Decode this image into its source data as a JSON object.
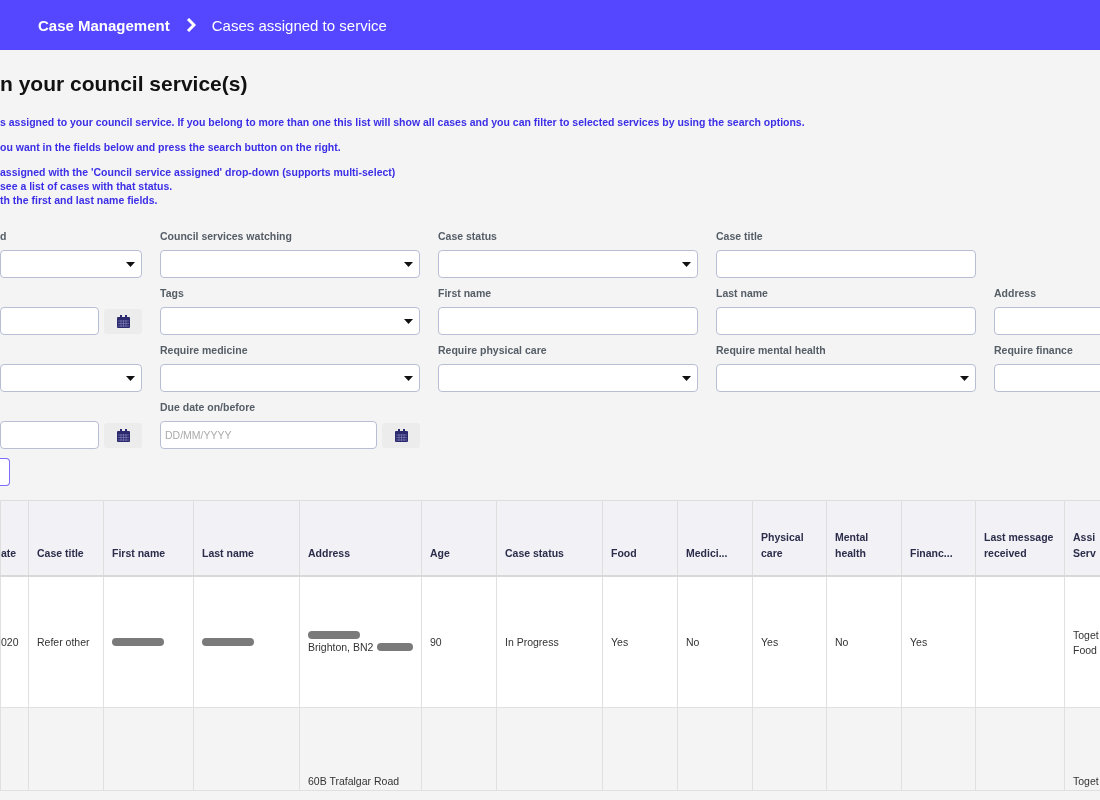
{
  "breadcrumb": {
    "parent": "Case Management",
    "current": "Cases assigned to service"
  },
  "heading": "n your council service(s)",
  "intro": [
    [
      "s assigned to your council service. If you belong to more than one this list will show all cases and you can filter to selected services by using the search options."
    ],
    [
      "ou want in the fields below and press the search button on the right."
    ],
    [
      "assigned with the 'Council service assigned' drop-down (supports multi-select)",
      "see a list of cases with that status.",
      "th the first and last name fields."
    ]
  ],
  "filters": [
    [
      {
        "kind": "select",
        "label": "d"
      },
      {
        "kind": "select",
        "label": "Council services watching"
      },
      {
        "kind": "select",
        "label": "Case status"
      },
      {
        "kind": "text",
        "label": "Case title"
      },
      {
        "kind": "empty"
      }
    ],
    [
      {
        "kind": "date"
      },
      {
        "kind": "select",
        "label": "Tags"
      },
      {
        "kind": "text",
        "label": "First name"
      },
      {
        "kind": "text",
        "label": "Last name"
      },
      {
        "kind": "text",
        "label": "Address"
      }
    ],
    [
      {
        "kind": "select"
      },
      {
        "kind": "select",
        "label": "Require medicine"
      },
      {
        "kind": "select",
        "label": "Require physical care"
      },
      {
        "kind": "select",
        "label": "Require mental health"
      },
      {
        "kind": "text",
        "label": "Require finance"
      }
    ],
    [
      {
        "kind": "date"
      },
      {
        "kind": "date",
        "label": "Due date on/before",
        "placeholder": "DD/MM/YYYY"
      },
      {
        "kind": "empty"
      },
      {
        "kind": "empty"
      },
      {
        "kind": "empty"
      }
    ],
    [
      {
        "kind": "button"
      },
      {
        "kind": "empty"
      },
      {
        "kind": "empty"
      },
      {
        "kind": "empty"
      },
      {
        "kind": "empty"
      }
    ]
  ],
  "table": {
    "columns": [
      "ate",
      "Case title",
      "First name",
      "Last name",
      "Address",
      "Age",
      "Case status",
      "Food",
      "Medici...",
      "Physical care",
      "Mental health",
      "Financ...",
      "Last message received",
      "Assi Serv"
    ],
    "rows": [
      {
        "cells": [
          [
            {
              "text": "020"
            }
          ],
          [
            {
              "text": "Refer other"
            }
          ],
          [
            {
              "redacted": true
            }
          ],
          [
            {
              "redacted": true
            }
          ],
          [
            {
              "redacted": true
            },
            {
              "text": "Brighton, BN2",
              "redacted": true
            }
          ],
          [
            {
              "text": "90"
            }
          ],
          [
            {
              "text": "In Progress"
            }
          ],
          [
            {
              "text": "Yes"
            }
          ],
          [
            {
              "text": "No"
            }
          ],
          [
            {
              "text": "Yes"
            }
          ],
          [
            {
              "text": "No"
            }
          ],
          [
            {
              "text": "Yes"
            }
          ],
          [],
          [
            {
              "text": "Toget"
            },
            {
              "text": "Food"
            }
          ]
        ]
      },
      {
        "cells": [
          [],
          [],
          [],
          [],
          [
            {
              "text": "60B Trafalgar Road"
            }
          ],
          [],
          [],
          [],
          [],
          [],
          [],
          [],
          [],
          [
            {
              "text": "Toget"
            }
          ]
        ]
      }
    ]
  }
}
